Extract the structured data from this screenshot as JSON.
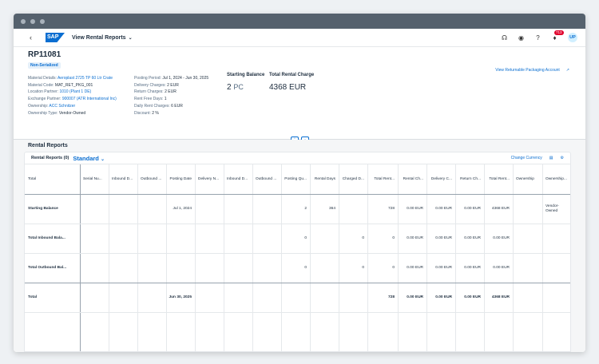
{
  "shell": {
    "logo_text": "SAP",
    "app_title": "View Rental Reports",
    "notification_count": "713",
    "avatar_initials": "UP"
  },
  "object": {
    "id": "RP11081",
    "status": "Non-Serialized",
    "link": "View Returnable Packaging Account",
    "attributes_left": [
      {
        "label": "Material Details:",
        "value": "Aeroplast 2725 TP 60 Ltr Crate",
        "link": true
      },
      {
        "label": "Material Code:",
        "value": "MAT_RET_PKG_001",
        "link": false
      },
      {
        "label": "Location Partner:",
        "value": "1010 (Plant 1 DE)",
        "link": true
      },
      {
        "label": "Exchange Partner:",
        "value": "900007 (ATR International Inc)",
        "link": true
      },
      {
        "label": "Ownership:",
        "value": "ACC Schnitzer",
        "link": true
      },
      {
        "label": "Ownership Type:",
        "value": "Vendor-Owned",
        "link": false
      }
    ],
    "attributes_mid": [
      {
        "label": "Posting Period:",
        "value": "Jul 1, 2024 - Jun 30, 2025"
      },
      {
        "label": "Delivery Charges:",
        "value": "2 EUR"
      },
      {
        "label": "Return Charges:",
        "value": "2 EUR"
      },
      {
        "label": "Rent Free Days:",
        "value": "1"
      },
      {
        "label": "Daily Rent Charges:",
        "value": "6 EUR"
      },
      {
        "label": "Discount:",
        "value": "2 %"
      }
    ],
    "kpis": [
      {
        "label": "Starting Balance",
        "value": "2",
        "unit": "PC"
      },
      {
        "label": "Total Rental Charge",
        "value": "4368 EUR",
        "unit": ""
      }
    ]
  },
  "section": {
    "title": "Rental Reports",
    "table_title": "Rental Reports (0)",
    "variant": "Standard",
    "change_currency": "Change Currency"
  },
  "table": {
    "columns": [
      "Total",
      "Serial Nu...",
      "Inbound D...",
      "Outbound ...",
      "Posting Date",
      "Delivery N...",
      "Inbound D...",
      "Outbound ...",
      "Posting Qu...",
      "Rental Days",
      "Charged D...",
      "Total Rent...",
      "Rental Ch...",
      "Delivery C...",
      "Return Ch...",
      "Total Rent...",
      "Ownership",
      "Ownership..."
    ],
    "rows": [
      [
        "Starting Balance",
        "",
        "",
        "",
        "Jul 1, 2024",
        "",
        "",
        "",
        "2",
        "364",
        "",
        "728",
        "0.00 EUR",
        "0.00 EUR",
        "0.00 EUR",
        "4368 EUR",
        "",
        "Vendor-Owned"
      ],
      [
        "Total Inbound Bala...",
        "",
        "",
        "",
        "",
        "",
        "",
        "",
        "0",
        "",
        "0",
        "0",
        "0.00 EUR",
        "0.00 EUR",
        "0.00 EUR",
        "0.00 EUR",
        "",
        ""
      ],
      [
        "Total Outbound Bal...",
        "",
        "",
        "",
        "",
        "",
        "",
        "",
        "0",
        "",
        "0",
        "0",
        "0.00 EUR",
        "0.00 EUR",
        "0.00 EUR",
        "0.00 EUR",
        "",
        ""
      ],
      [
        "Total",
        "",
        "",
        "",
        "Jun 30, 2025",
        "",
        "",
        "",
        "",
        "",
        "",
        "728",
        "0.00 EUR",
        "0.00 EUR",
        "0.00 EUR",
        "4368 EUR",
        "",
        ""
      ]
    ]
  }
}
